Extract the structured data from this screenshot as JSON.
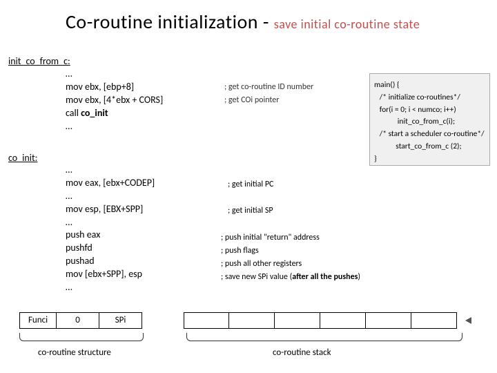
{
  "title_main": "Co-routine initialization - ",
  "title_sub": "save initial co-routine state",
  "label_init_from_c": "init_co_from_c:",
  "label_co_init": "co_init:",
  "code_block1_pre": "…\nmov ebx, [ebp+8]\nmov ebx, [4*ebx + CORS]\ncall ",
  "code_block1_bold": "co_init",
  "code_block1_post": "\n…",
  "comments1": "; get co-routine ID number\n; get COi pointer",
  "code_block2": "…\nmov eax, [ebx+CODEP]\n…\nmov esp, [EBX+SPP]\n…\npush eax\npushfd\npushad\nmov [ebx+SPP], esp\n…",
  "comments2": "; get initial PC\n\n; get initial SP",
  "comments3_pre": "; push initial \"return\" address\n; push flags\n; push all other registers\n; save new SPi value (",
  "comments3_bold": "after all the pushes",
  "comments3_post": ")",
  "mainbox": "main() {\n   /* initialize co-routines*/\n   for(i = 0; i < numco; i++)\n             init_co_from_c(i);\n   /* start a scheduler co-routine*/\n            start_co_from_c (2);\n}",
  "cell_func": "Funci",
  "cell_zero": "0",
  "cell_spi": "SPi",
  "brace_label1": "co-routine structure",
  "brace_label2": "co-routine stack"
}
